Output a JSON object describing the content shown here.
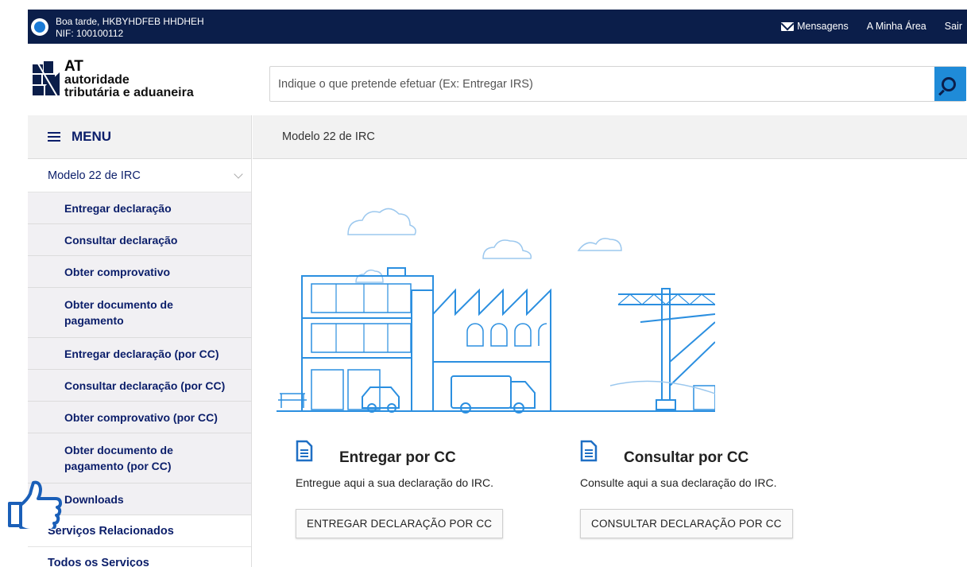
{
  "topbar": {
    "greeting": "Boa tarde, HKBYHDFEB HHDHEH",
    "nif": "NIF: 100100112",
    "links": {
      "messages": "Mensagens",
      "my_area": "A Minha Área",
      "logout": "Sair"
    }
  },
  "header": {
    "logo": {
      "short": "AT",
      "line1": "autoridade",
      "line2": "tributária e aduaneira"
    },
    "search": {
      "placeholder": "Indique o que pretende efetuar (Ex: Entregar IRS)"
    }
  },
  "sidebar": {
    "menu_label": "MENU",
    "section": "Modelo 22 de IRC",
    "items": [
      "Entregar declaração",
      "Consultar declaração",
      "Obter comprovativo",
      "Obter documento de pagamento",
      "Entregar declaração (por CC)",
      "Consultar declaração (por CC)",
      "Obter comprovativo (por CC)",
      "Obter documento de pagamento (por CC)",
      "Downloads"
    ],
    "related": "Serviços Relacionados",
    "all_services": "Todos os Serviços"
  },
  "main": {
    "breadcrumb": "Modelo 22 de IRC",
    "cards": [
      {
        "title": "Entregar por CC",
        "desc": "Entregue aqui a sua declaração do IRC.",
        "button": "ENTREGAR DECLARAÇÃO POR CC"
      },
      {
        "title": "Consultar por CC",
        "desc": "Consulte aqui a sua declaração do IRC.",
        "button": "CONSULTAR DECLARAÇÃO POR CC"
      }
    ]
  },
  "colors": {
    "navy": "#0b1e4a",
    "accent": "#1f8bd8",
    "illustration": "#2b8fe0"
  },
  "icons": [
    "mail-icon",
    "search-icon",
    "menu-icon",
    "chevron-down-icon",
    "document-icon",
    "thumbs-up-cursor-icon"
  ]
}
